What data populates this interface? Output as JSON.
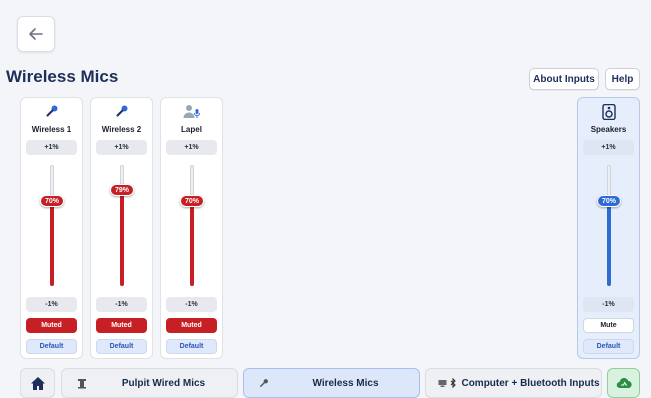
{
  "page": {
    "title": "Wireless Mics"
  },
  "header": {
    "back_icon": "arrow-left-icon",
    "about_label": "About Inputs",
    "help_label": "Help"
  },
  "colors": {
    "accent_red": "#c61f24",
    "accent_blue": "#2f6bd6",
    "title": "#1d2f5a"
  },
  "channels": [
    {
      "name": "Wireless 1",
      "icon": "microphone-icon",
      "up_label": "+1%",
      "down_label": "-1%",
      "level_label": "70%",
      "level": 0.7,
      "mute_label": "Muted",
      "muted": true,
      "default_label": "Default"
    },
    {
      "name": "Wireless 2",
      "icon": "microphone-icon",
      "up_label": "+1%",
      "down_label": "-1%",
      "level_label": "79%",
      "level": 0.79,
      "mute_label": "Muted",
      "muted": true,
      "default_label": "Default"
    },
    {
      "name": "Lapel",
      "icon": "person-mic-icon",
      "up_label": "+1%",
      "down_label": "-1%",
      "level_label": "70%",
      "level": 0.7,
      "mute_label": "Muted",
      "muted": true,
      "default_label": "Default"
    }
  ],
  "output": {
    "name": "Speakers",
    "icon": "speaker-icon",
    "up_label": "+1%",
    "down_label": "-1%",
    "level_label": "70%",
    "level": 0.7,
    "mute_label": "Mute",
    "muted": false,
    "default_label": "Default"
  },
  "bottom_nav": {
    "home_icon": "home-icon",
    "items": [
      {
        "label": "Pulpit Wired Mics",
        "icon": "podium-icon",
        "active": false
      },
      {
        "label": "Wireless Mics",
        "icon": "microphone-icon",
        "active": true
      },
      {
        "label": "Computer + Bluetooth Inputs",
        "icon": "computer-bluetooth-icon",
        "active": false
      }
    ],
    "cloud_icon": "cloud-status-icon"
  }
}
